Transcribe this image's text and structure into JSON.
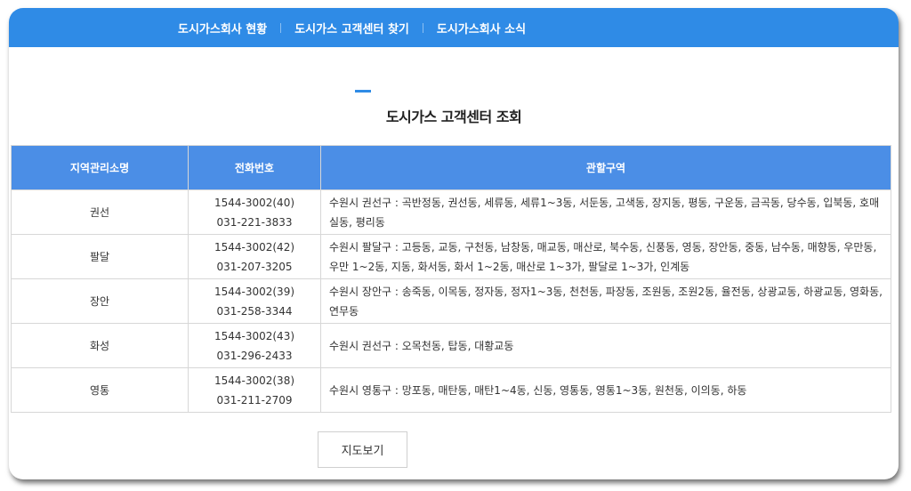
{
  "nav": {
    "items": [
      {
        "label": "도시가스회사 현황"
      },
      {
        "label": "도시가스 고객센터 찾기"
      },
      {
        "label": "도시가스회사 소식"
      }
    ]
  },
  "page": {
    "title": "도시가스 고객센터 조회",
    "accent_color": "#2f8be6"
  },
  "table": {
    "headers": [
      "지역관리소명",
      "전화번호",
      "관할구역"
    ],
    "rows": [
      {
        "name": "권선",
        "phone1": "1544-3002(40)",
        "phone2": "031-221-3833",
        "area": "수원시 권선구 : 곡반정동, 권선동, 세류동, 세류1~3동, 서둔동, 고색동, 장지동, 평동, 구운동, 금곡동, 당수동, 입북동, 호매실동, 평리동"
      },
      {
        "name": "팔달",
        "phone1": "1544-3002(42)",
        "phone2": "031-207-3205",
        "area": "수원시 팔달구 : 고등동, 교동, 구천동, 남창동, 매교동, 매산로, 북수동, 신풍동, 영동, 장안동, 중동, 남수동, 매향동, 우만동, 우만 1~2동, 지동, 화서동, 화서 1~2동, 매산로 1~3가, 팔달로 1~3가, 인계동"
      },
      {
        "name": "장안",
        "phone1": "1544-3002(39)",
        "phone2": "031-258-3344",
        "area": "수원시 장안구 : 송죽동, 이목동, 정자동, 정자1~3동, 천천동, 파장동, 조원동, 조원2동, 율전동, 상광교동, 하광교동, 영화동, 연무동"
      },
      {
        "name": "화성",
        "phone1": "1544-3002(43)",
        "phone2": "031-296-2433",
        "area": "수원시 권선구 : 오목천동, 탑동, 대황교동"
      },
      {
        "name": "영통",
        "phone1": "1544-3002(38)",
        "phone2": "031-211-2709",
        "area": "수원시 영통구 : 망포동, 매탄동, 매탄1~4동, 신동, 영통동, 영통1~3동, 원천동, 이의동, 하동"
      }
    ]
  },
  "map_button": {
    "label": "지도보기"
  },
  "colors": {
    "nav_bg": "#2f8be6",
    "table_header_bg": "#4b8ee6",
    "border": "#d7d7d7"
  }
}
